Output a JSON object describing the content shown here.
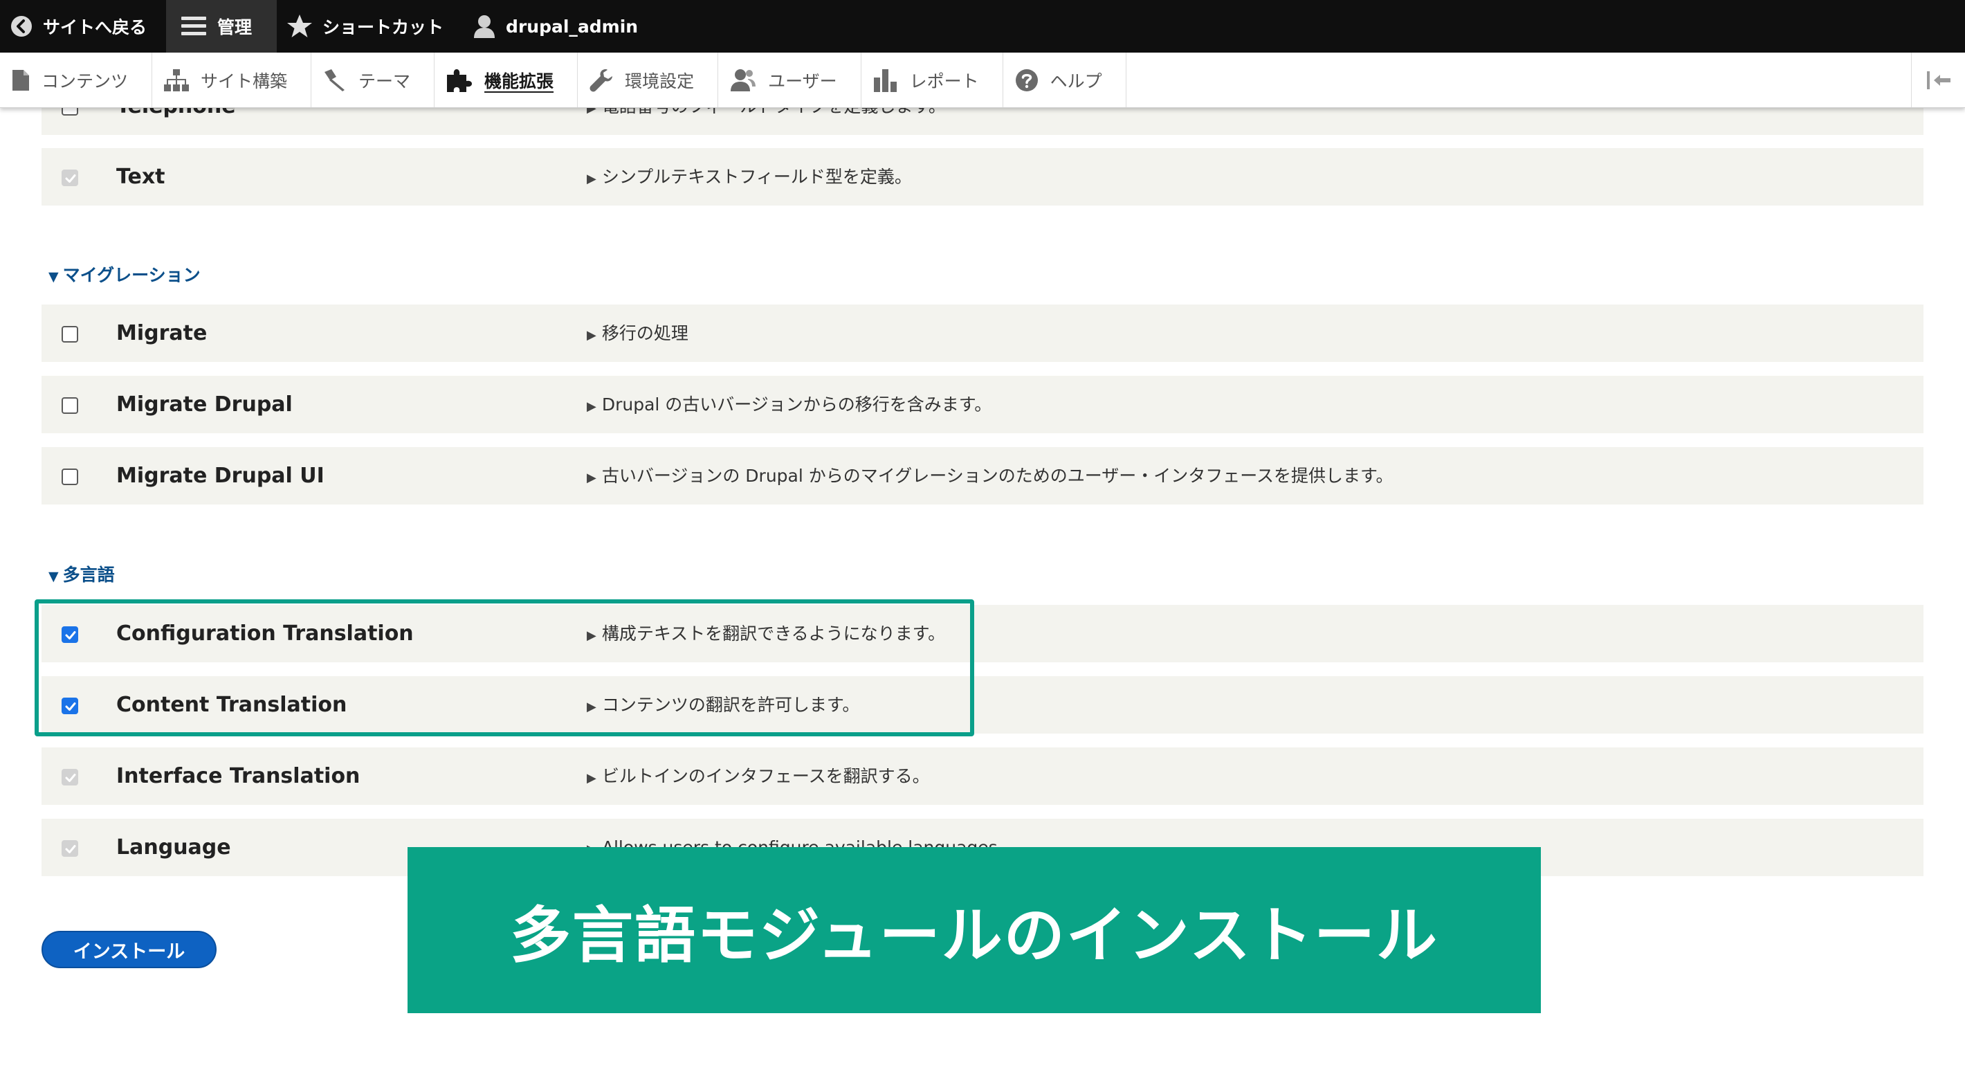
{
  "toolbar": {
    "back_label": "サイトへ戻る",
    "manage_label": "管理",
    "shortcuts_label": "ショートカット",
    "user_label": "drupal_admin"
  },
  "tray": {
    "items": [
      {
        "label": "コンテンツ",
        "icon": "document-icon"
      },
      {
        "label": "サイト構築",
        "icon": "sitemap-icon"
      },
      {
        "label": "テーマ",
        "icon": "paintbrush-icon"
      },
      {
        "label": "機能拡張",
        "icon": "puzzle-icon",
        "active": true
      },
      {
        "label": "環境設定",
        "icon": "wrench-icon"
      },
      {
        "label": "ユーザー",
        "icon": "people-icon"
      },
      {
        "label": "レポート",
        "icon": "bar-chart-icon"
      },
      {
        "label": "ヘルプ",
        "icon": "help-icon"
      }
    ]
  },
  "modules": {
    "telephone": {
      "name": "Telephone",
      "desc": "電話番号のフィールドタイプを定義します。"
    },
    "text": {
      "name": "Text",
      "desc": "シンプルテキストフィールド型を定義。",
      "checked": true,
      "disabled": true
    }
  },
  "migration": {
    "title": "マイグレーション",
    "rows": [
      {
        "name": "Migrate",
        "desc": "移行の処理",
        "checked": false
      },
      {
        "name": "Migrate Drupal",
        "desc": "Drupal の古いバージョンからの移行を含みます。",
        "checked": false
      },
      {
        "name": "Migrate Drupal UI",
        "desc": "古いバージョンの Drupal からのマイグレーションのためのユーザー・インタフェースを提供します。",
        "checked": false
      }
    ]
  },
  "multilingual": {
    "title": "多言語",
    "rows": [
      {
        "name": "Configuration Translation",
        "desc": "構成テキストを翻訳できるようになります。",
        "checked": true
      },
      {
        "name": "Content Translation",
        "desc": "コンテンツの翻訳を許可します。",
        "checked": true
      },
      {
        "name": "Interface Translation",
        "desc": "ビルトインのインタフェースを翻訳する。",
        "checked": true,
        "disabled": true
      },
      {
        "name": "Language",
        "desc": "Allows users to configure available languages.",
        "checked": true,
        "disabled": true
      }
    ]
  },
  "install_label": "インストール",
  "banner_text": "多言語モジュールのインストール",
  "colors": {
    "toolbar_bg": "#0f0f0f",
    "row_bg": "#f3f3ee",
    "section_title": "#0b4f8a",
    "checkbox_checked": "#1a73e8",
    "highlight": "#0a9f8a",
    "banner_bg": "#0aa386",
    "button_bg": "#0e62c2"
  }
}
